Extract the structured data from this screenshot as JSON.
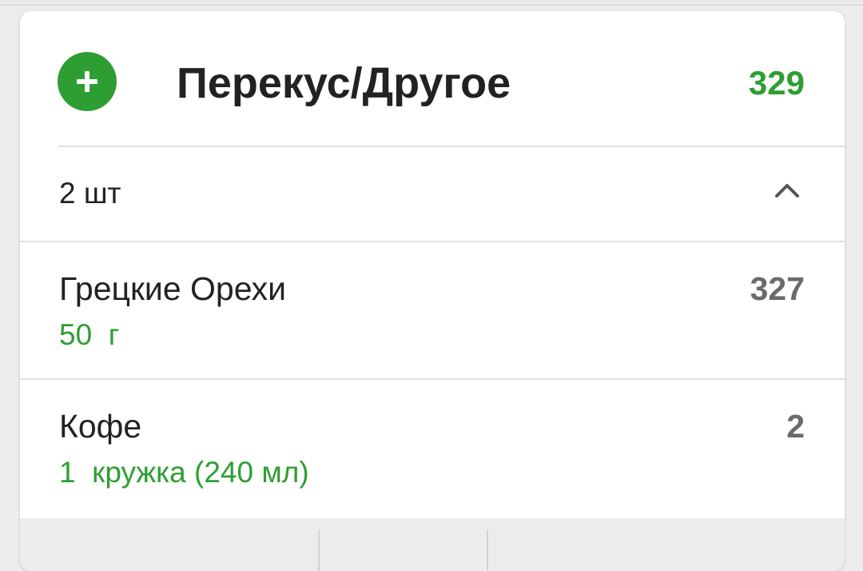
{
  "meal": {
    "title": "Перекус/Другое",
    "total_calories": "329",
    "accent_color": "#2e9e33",
    "add_icon": "plus-circle-icon"
  },
  "summary": {
    "count_label": "2 шт",
    "toggle_icon": "chevron-up-icon"
  },
  "items": [
    {
      "name": "Грецкие Орехи",
      "amount": "50  г",
      "calories": "327"
    },
    {
      "name": "Кофе",
      "amount": "1  кружка (240 мл)",
      "calories": "2"
    }
  ]
}
